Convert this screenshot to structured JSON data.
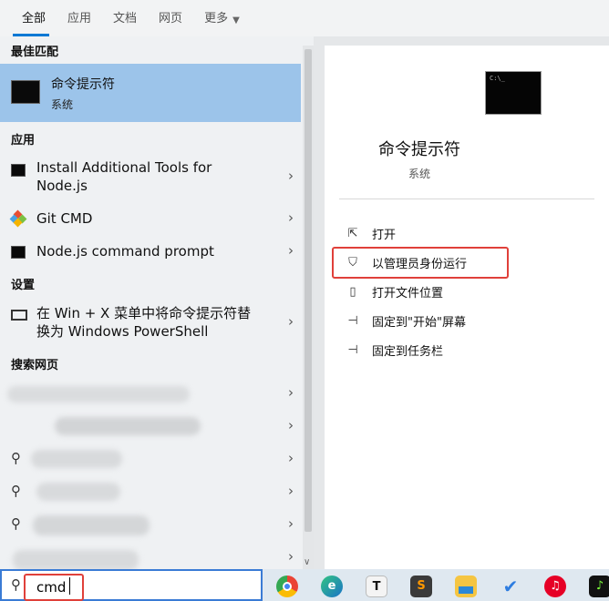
{
  "tabs": [
    "全部",
    "应用",
    "文档",
    "网页",
    "更多"
  ],
  "best_match": {
    "heading": "最佳匹配",
    "name": "命令提示符",
    "sub": "系统"
  },
  "apps": {
    "heading": "应用",
    "items": [
      {
        "label_line1": "Install Additional Tools for",
        "label_line2": "Node.js",
        "icon": "terminal-icon"
      },
      {
        "label_line1": "Git CMD",
        "label_line2": "",
        "icon": "git-icon"
      },
      {
        "label_line1": "Node.js command prompt",
        "label_line2": "",
        "icon": "terminal-icon"
      }
    ]
  },
  "settings": {
    "heading": "设置",
    "item_line1": "在 Win + X 菜单中将命令提示符替",
    "item_line2": "换为 Windows PowerShell"
  },
  "web": {
    "heading": "搜索网页"
  },
  "detail": {
    "title": "命令提示符",
    "subtitle": "系统",
    "actions": [
      {
        "label": "打开",
        "icon": "open-icon"
      },
      {
        "label": "以管理员身份运行",
        "icon": "shield-icon"
      },
      {
        "label": "打开文件位置",
        "icon": "folder-icon"
      },
      {
        "label": "固定到\"开始\"屏幕",
        "icon": "pin-icon"
      },
      {
        "label": "固定到任务栏",
        "icon": "pin-icon"
      }
    ]
  },
  "search": {
    "query": "cmd"
  },
  "taskbar_icons": [
    "chrome-icon",
    "edge-icon",
    "typora-icon",
    "sublime-icon",
    "file-explorer-icon",
    "todo-icon",
    "netease-music-icon",
    "music-icon"
  ]
}
